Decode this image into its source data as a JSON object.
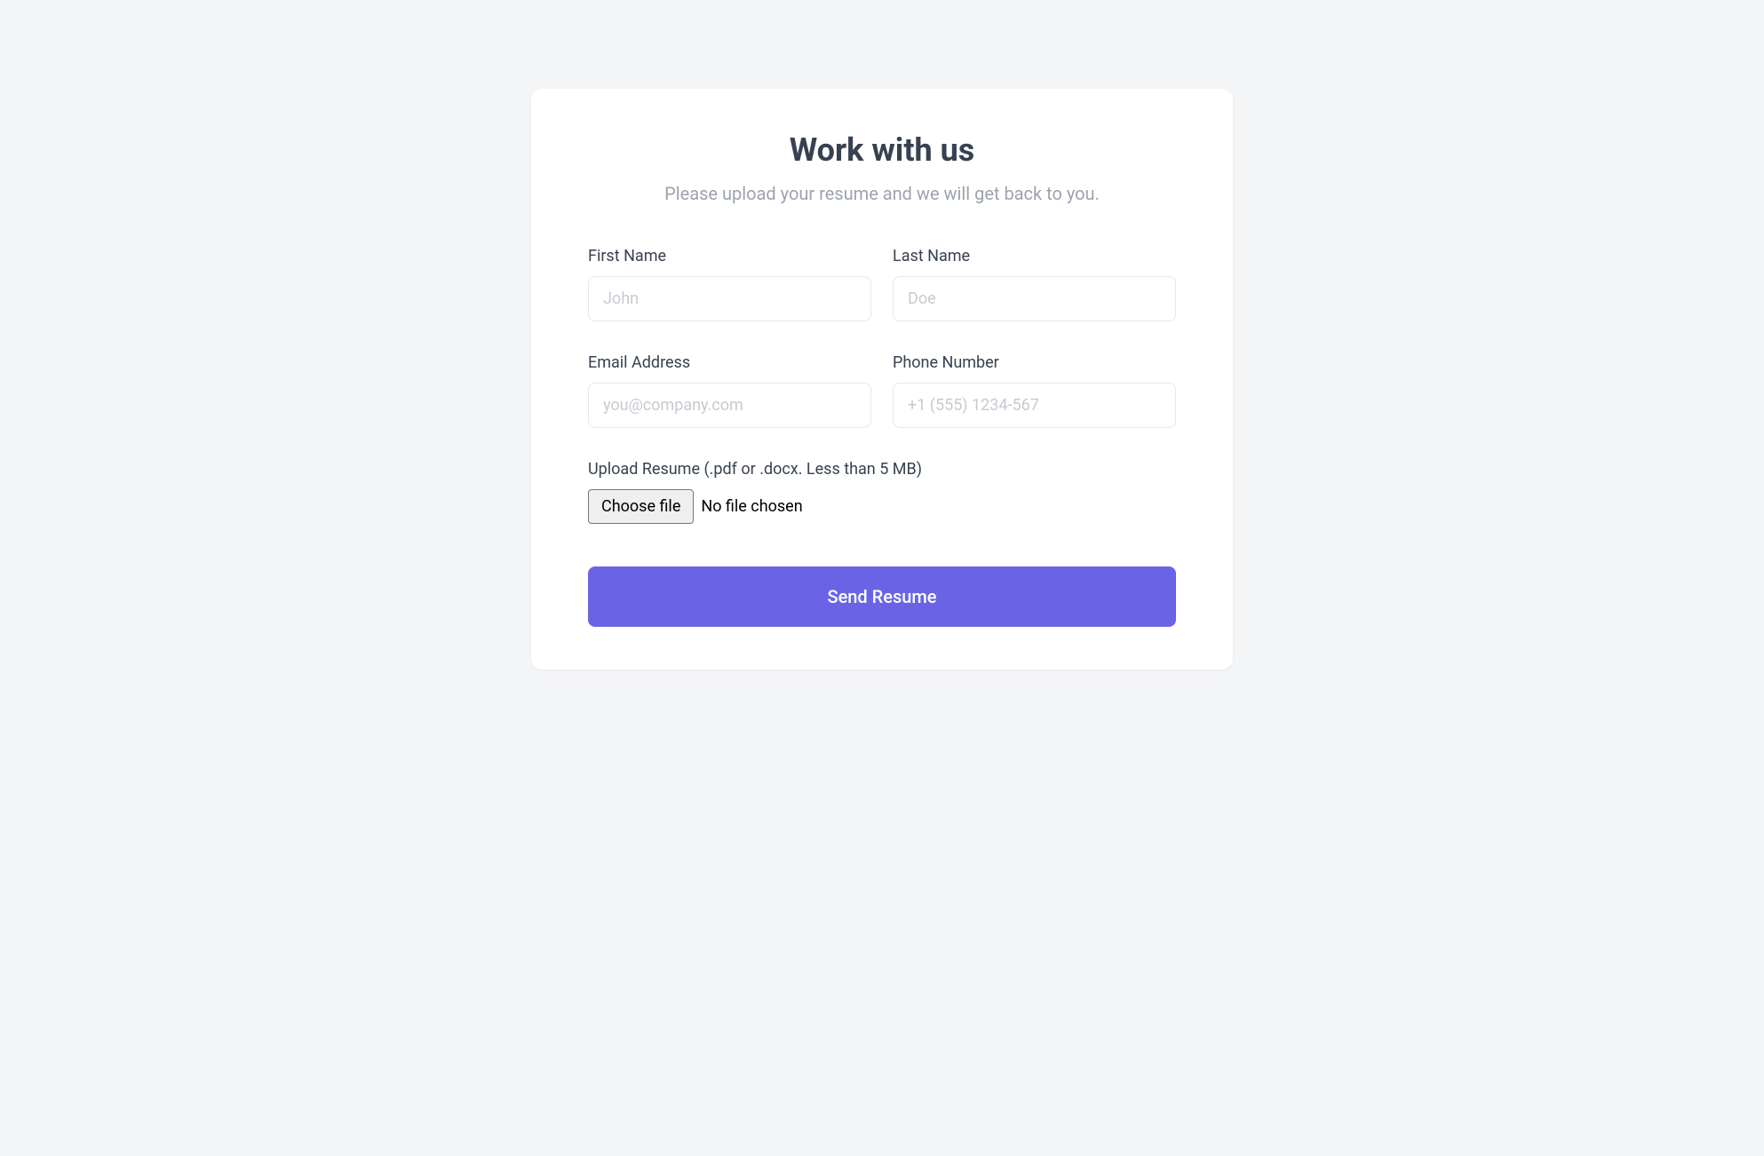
{
  "heading": "Work with us",
  "subheading": "Please upload your resume and we will get back to you.",
  "fields": {
    "first_name": {
      "label": "First Name",
      "placeholder": "John"
    },
    "last_name": {
      "label": "Last Name",
      "placeholder": "Doe"
    },
    "email": {
      "label": "Email Address",
      "placeholder": "you@company.com"
    },
    "phone": {
      "label": "Phone Number",
      "placeholder": "+1 (555) 1234-567"
    }
  },
  "upload": {
    "label": "Upload Resume (.pdf or .docx. Less than 5 MB)",
    "button": "Choose file",
    "status": "No file chosen"
  },
  "submit_label": "Send Resume"
}
